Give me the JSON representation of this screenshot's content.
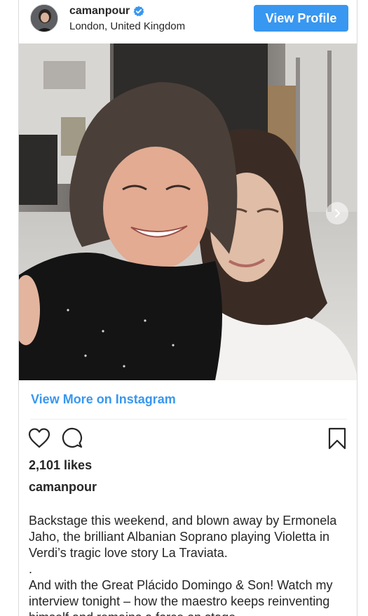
{
  "post": {
    "username": "camanpour",
    "location": "London, United Kingdom",
    "view_profile_label": "View Profile",
    "view_more_label": "View More on Instagram",
    "likes": "2,101 likes",
    "caption_username": "camanpour",
    "caption_lines": [
      "Backstage this weekend, and blown away by Ermonela Jaho, the brilliant Albanian Soprano playing Violetta in Verdi’s tragic love story La Traviata.",
      ".",
      "And with the Great Plácido Domingo & Son! Watch my interview tonight – how the maestro keeps reinventing himself and remains a force on stage."
    ]
  },
  "icons": {
    "verified": "verified-badge-icon",
    "heart": "heart-icon",
    "comment": "comment-icon",
    "bookmark": "bookmark-icon",
    "next": "chevron-right-icon"
  },
  "colors": {
    "accent": "#3897f0",
    "text": "#262626",
    "border": "#dbdbdb"
  }
}
